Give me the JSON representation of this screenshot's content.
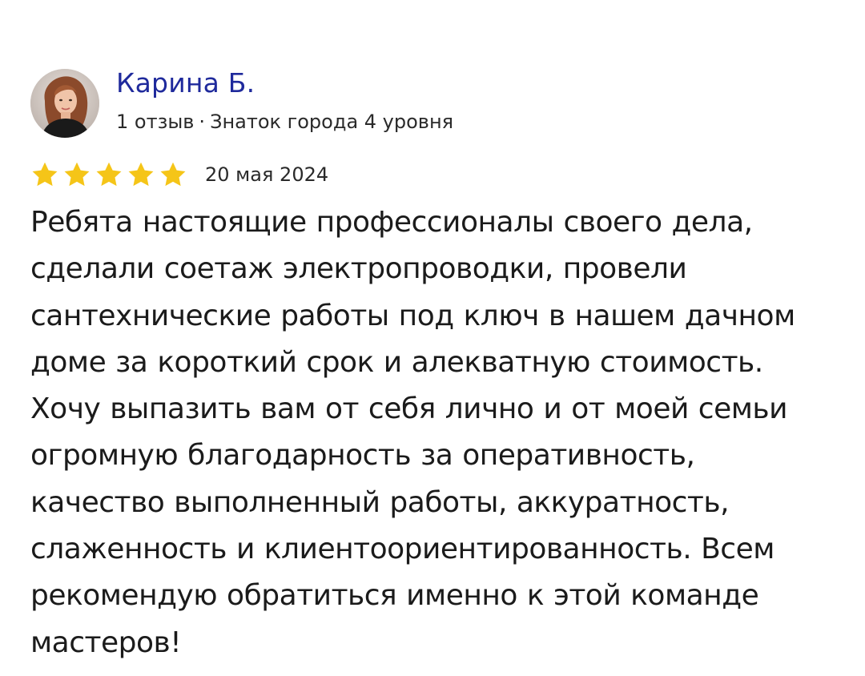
{
  "review": {
    "author": {
      "name": "Карина Б.",
      "reviews_count": "1 отзыв",
      "separator": "·",
      "level": "Знаток города 4 уровня",
      "avatar_icon": "user-avatar-photo"
    },
    "rating": {
      "stars": 5,
      "max_stars": 5,
      "star_color": "#f5c518",
      "star_icon": "star-icon"
    },
    "date": "20 мая 2024",
    "text_lines": [
      "Ребята настоящие профессионалы своего дела,",
      "сделали соетаж электропроводки, провели",
      "сантехнические работы под ключ в нашем дачном",
      "доме за короткий срок и алекватную стоимость.",
      "Хочу выпазить вам от себя лично и от моей семьи",
      "огромную благодарность за оперативность,",
      "качество выполненный работы, аккуратность,",
      "слаженность и клиентоориентированность. Всем",
      "рекомендую обратиться именно к этой команде",
      "мастеров!"
    ]
  },
  "colors": {
    "author_name": "#1f2a9c",
    "text": "#1b1b1b",
    "meta": "#2a2a2a",
    "star": "#f5c518",
    "background": "#ffffff"
  }
}
